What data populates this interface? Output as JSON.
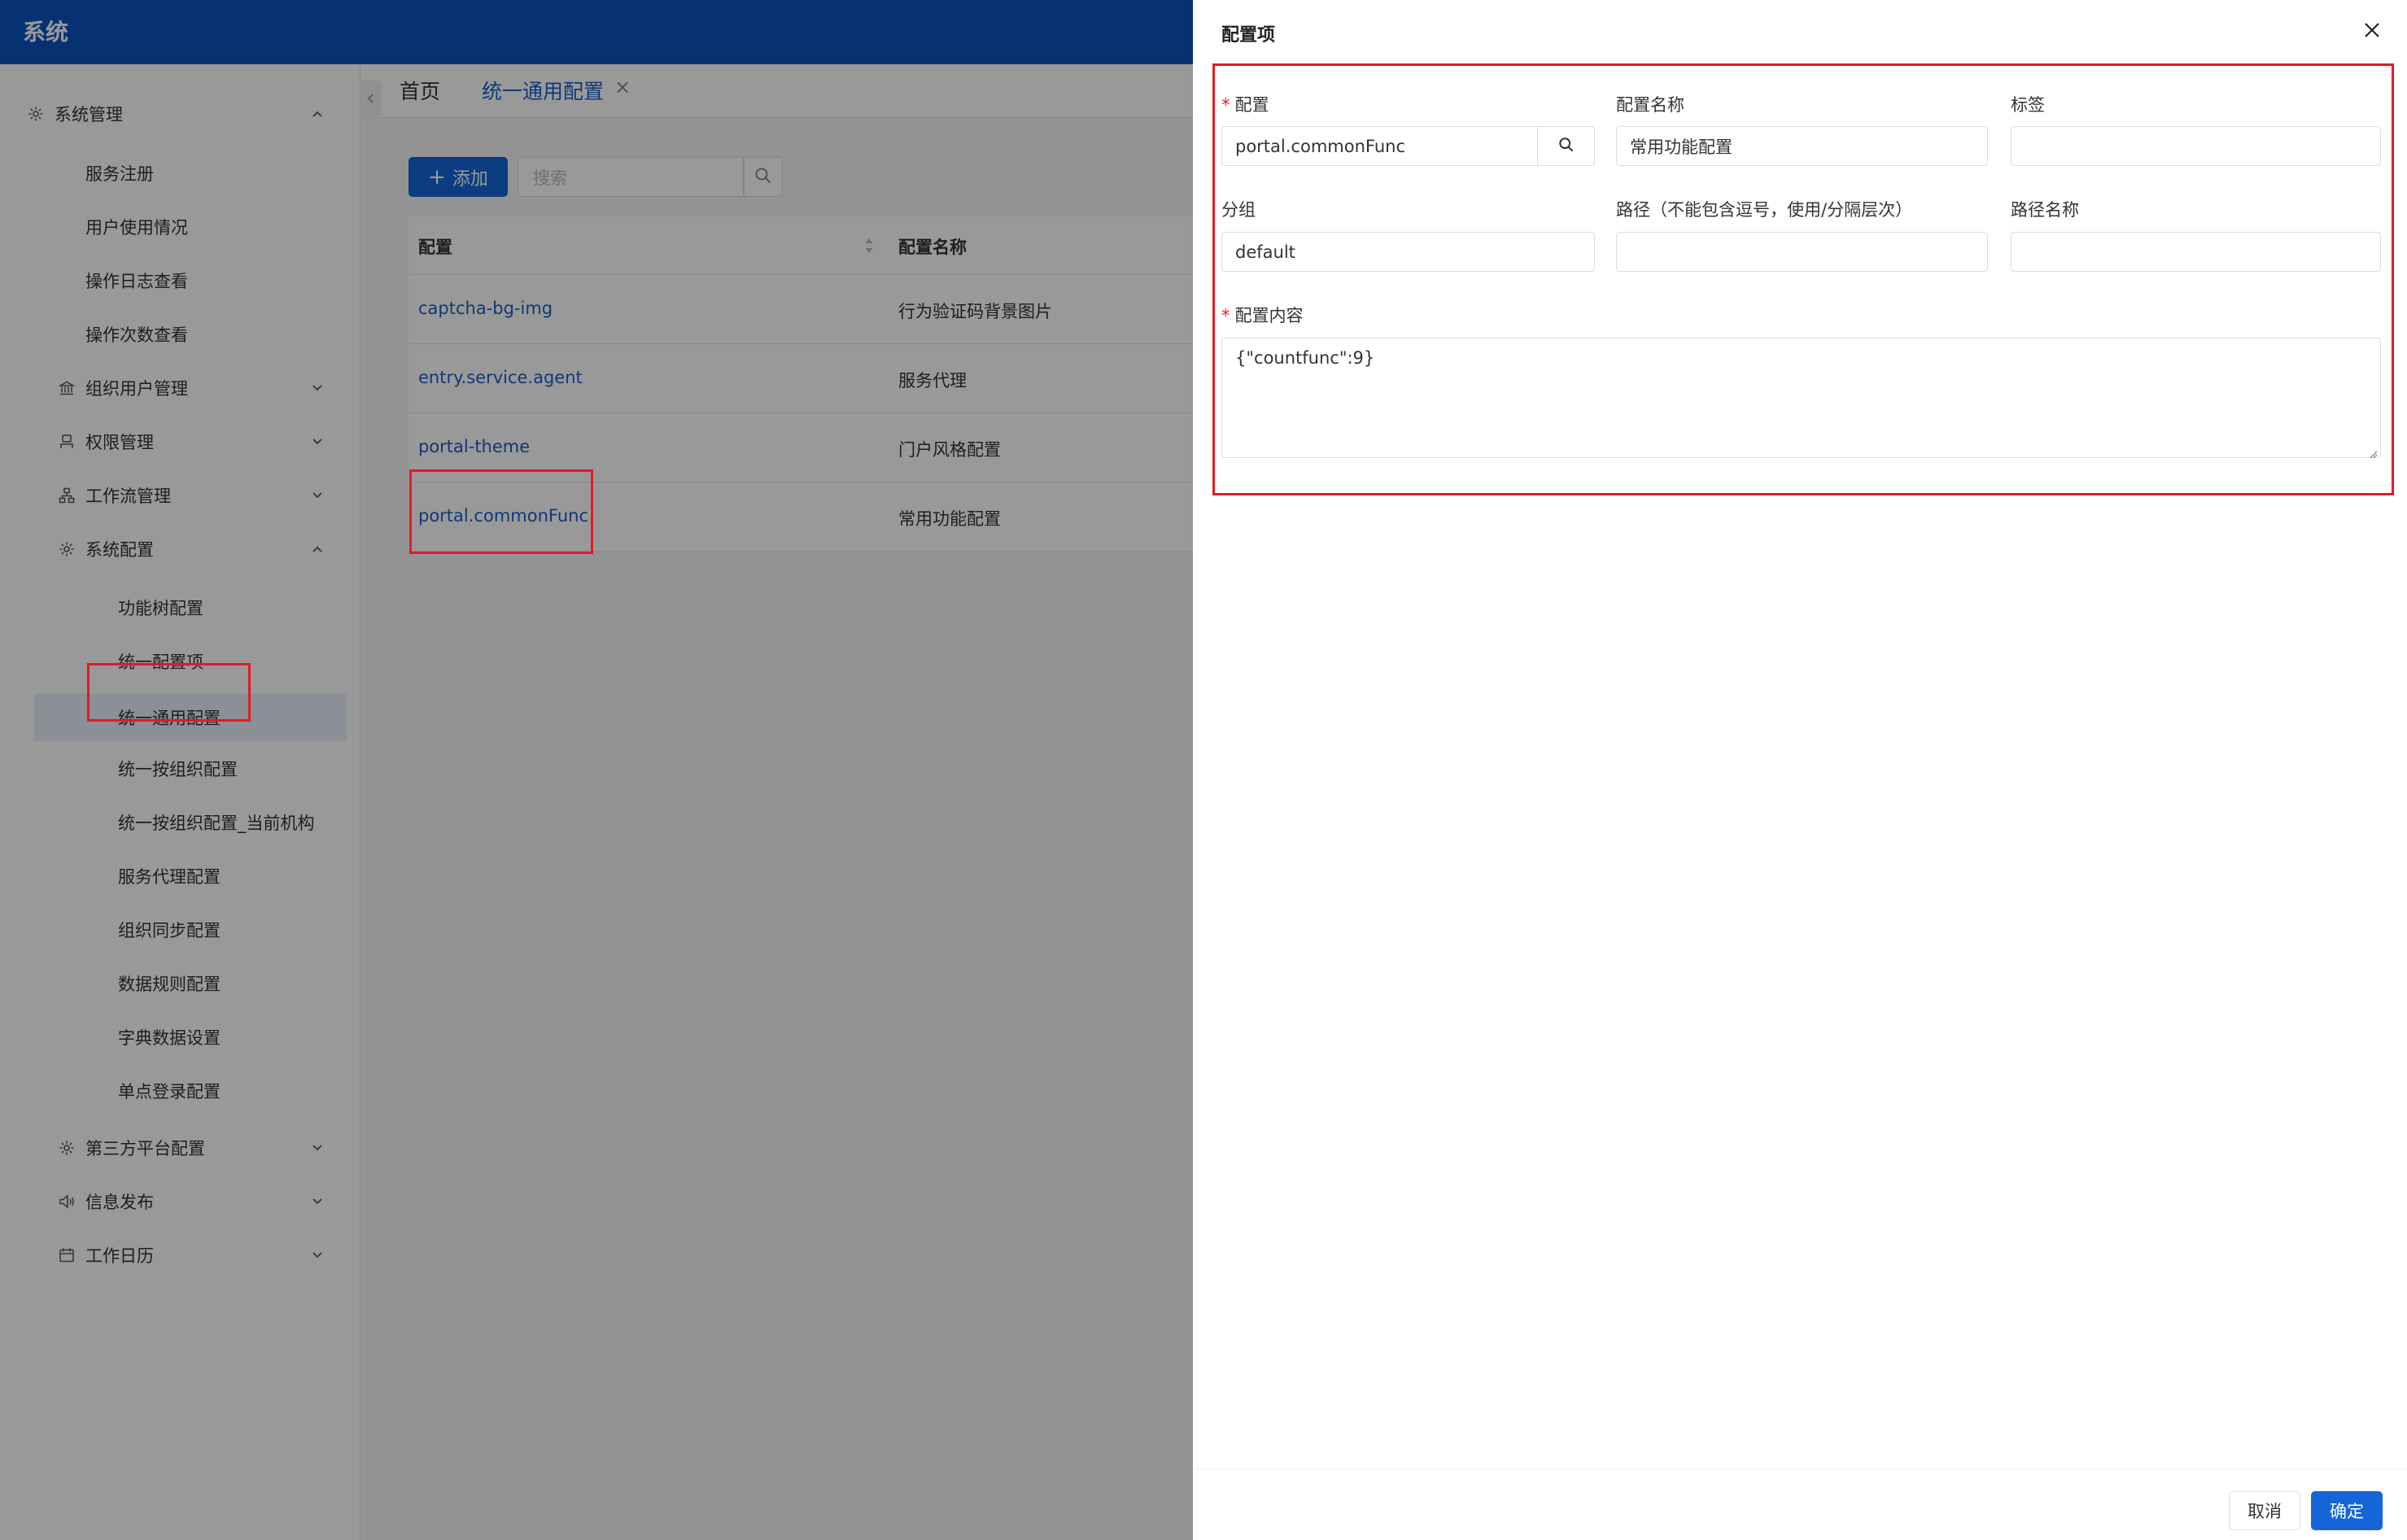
{
  "app": {
    "title": "系统"
  },
  "sidebar": {
    "items": [
      {
        "label": "系统管理",
        "icon": "gear-icon",
        "level": 1,
        "expanded": true
      },
      {
        "label": "服务注册",
        "level": 2
      },
      {
        "label": "用户使用情况",
        "level": 2
      },
      {
        "label": "操作日志查看",
        "level": 2
      },
      {
        "label": "操作次数查看",
        "level": 2
      },
      {
        "label": "组织用户管理",
        "icon": "bank-icon",
        "level": 2,
        "expanded": false
      },
      {
        "label": "权限管理",
        "icon": "user-icon",
        "level": 2,
        "expanded": false
      },
      {
        "label": "工作流管理",
        "icon": "workflow-icon",
        "level": 2,
        "expanded": false
      },
      {
        "label": "系统配置",
        "icon": "gear-icon",
        "level": 2,
        "expanded": true
      },
      {
        "label": "功能树配置",
        "level": 3
      },
      {
        "label": "统一配置项",
        "level": 3
      },
      {
        "label": "统一通用配置",
        "level": 3,
        "active": true
      },
      {
        "label": "统一按组织配置",
        "level": 3
      },
      {
        "label": "统一按组织配置_当前机构",
        "level": 3
      },
      {
        "label": "服务代理配置",
        "level": 3
      },
      {
        "label": "组织同步配置",
        "level": 3
      },
      {
        "label": "数据规则配置",
        "level": 3
      },
      {
        "label": "字典数据设置",
        "level": 3
      },
      {
        "label": "单点登录配置",
        "level": 3
      },
      {
        "label": "第三方平台配置",
        "icon": "gear-icon",
        "level": 2,
        "expanded": false
      },
      {
        "label": "信息发布",
        "icon": "speaker-icon",
        "level": 2,
        "expanded": false
      },
      {
        "label": "工作日历",
        "icon": "calendar-icon",
        "level": 2,
        "expanded": false
      }
    ]
  },
  "tabs": [
    {
      "label": "首页"
    },
    {
      "label": "统一通用配置",
      "active": true,
      "closable": true
    }
  ],
  "toolbar": {
    "add_label": "添加",
    "search_placeholder": "搜索"
  },
  "table": {
    "columns": [
      "配置",
      "配置名称"
    ],
    "rows": [
      {
        "key": "captcha-bg-img",
        "name": "行为验证码背景图片"
      },
      {
        "key": "entry.service.agent",
        "name": "服务代理"
      },
      {
        "key": "portal-theme",
        "name": "门户风格配置"
      },
      {
        "key": "portal.commonFunc",
        "name": "常用功能配置"
      }
    ]
  },
  "drawer": {
    "title": "配置项",
    "fields": {
      "config_label": "配置",
      "config_value": "portal.commonFunc",
      "name_label": "配置名称",
      "name_value": "常用功能配置",
      "tag_label": "标签",
      "tag_value": "",
      "group_label": "分组",
      "group_value": "default",
      "path_label": "路径（不能包含逗号，使用/分隔层次）",
      "path_value": "",
      "path_name_label": "路径名称",
      "path_name_value": "",
      "content_label": "配置内容",
      "content_value": "{\"countfunc\":9}"
    },
    "cancel_label": "取消",
    "ok_label": "确定"
  },
  "colors": {
    "header": "#0a52be",
    "primary": "#1565d8",
    "link": "#1a5fc8",
    "highlight": "#e21b24"
  }
}
